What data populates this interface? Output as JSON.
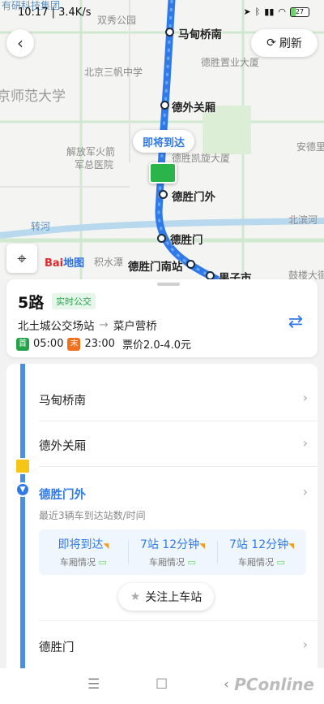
{
  "status_bar": {
    "time": "10:17",
    "net_speed": "3.4K/s",
    "battery": "27"
  },
  "map": {
    "place_labels": [
      "双秀公园",
      "北京三帆中学",
      "德胜置业大厦",
      "京师范大学",
      "解放军火箭",
      "军总医院",
      "德胜凯旋大厦",
      "安德里",
      "转河",
      "北滨河",
      "积水潭",
      "鼓楼大街",
      "有研科技集团"
    ],
    "stop_labels": [
      "马甸桥南",
      "德外关厢",
      "德胜门外",
      "德胜门",
      "德胜门南站",
      "果子市"
    ],
    "bubble": "即将到达",
    "baidu": "Bai",
    "baidu_cn": "地图"
  },
  "buttons": {
    "back": "‹",
    "refresh": "刷新"
  },
  "route": {
    "name": "5路",
    "badge": "实时公交",
    "from": "北土城公交场站",
    "to": "菜户营桥",
    "first_tag": "首",
    "first_time": "05:00",
    "last_tag": "末",
    "last_time": "23:00",
    "fare": "票价2.0-4.0元"
  },
  "stops": [
    {
      "name": "马甸桥南"
    },
    {
      "name": "德外关厢"
    },
    {
      "name": "德胜门外"
    },
    {
      "name": "德胜门"
    }
  ],
  "current_stop_hint": "最近3辆车到达站数/时间",
  "eta": [
    {
      "main": "即将到达",
      "sub": "车厢情况"
    },
    {
      "main": "7站 12分钟",
      "sub": "车厢情况"
    },
    {
      "main": "7站 12分钟",
      "sub": "车厢情况"
    }
  ],
  "follow_button": "关注上车站",
  "navbar": {
    "menu": "☰",
    "home": "☐",
    "back": "‹"
  },
  "watermark": "PConline",
  "colors": {
    "accent": "#2f79e8",
    "route": "#4a90e2",
    "green": "#24a34a",
    "orange": "#f07020"
  }
}
